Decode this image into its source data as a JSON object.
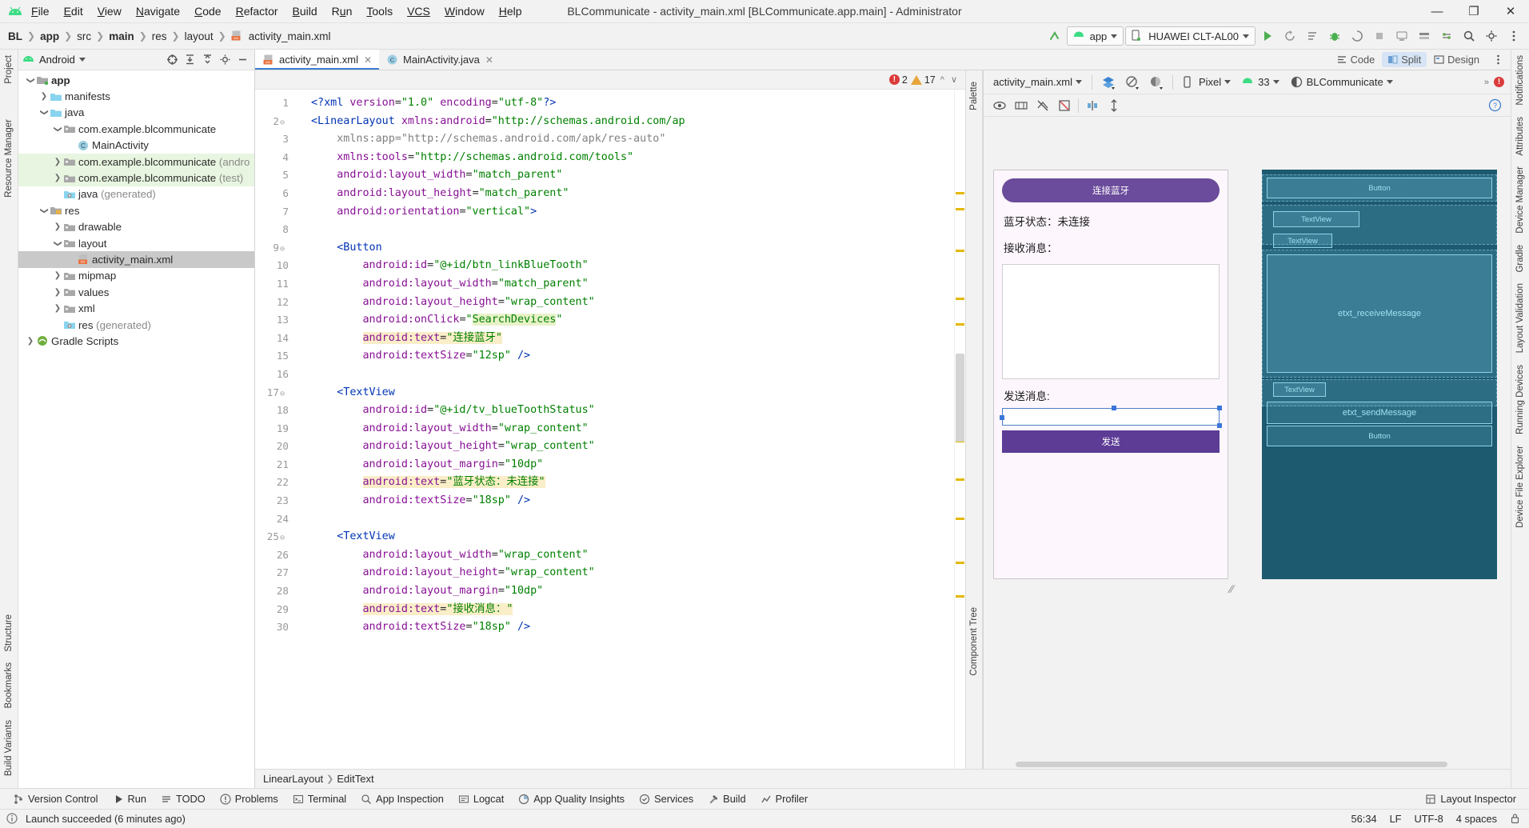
{
  "window": {
    "title": "BLCommunicate - activity_main.xml [BLCommunicate.app.main] - Administrator",
    "minimize": "—",
    "maximize": "❐",
    "close": "✕"
  },
  "menu": {
    "items": [
      {
        "label": "File",
        "mnemonic": "F"
      },
      {
        "label": "Edit",
        "mnemonic": "E"
      },
      {
        "label": "View",
        "mnemonic": "V"
      },
      {
        "label": "Navigate",
        "mnemonic": "N"
      },
      {
        "label": "Code",
        "mnemonic": "C"
      },
      {
        "label": "Refactor",
        "mnemonic": "R"
      },
      {
        "label": "Build",
        "mnemonic": "B"
      },
      {
        "label": "Run",
        "mnemonic": "u"
      },
      {
        "label": "Tools",
        "mnemonic": "T"
      },
      {
        "label": "VCS",
        "mnemonic": ""
      },
      {
        "label": "Window",
        "mnemonic": "W"
      },
      {
        "label": "Help",
        "mnemonic": "H"
      }
    ]
  },
  "breadcrumb": {
    "segments": [
      "BL",
      "app",
      "src",
      "main",
      "res",
      "layout",
      "activity_main.xml"
    ]
  },
  "toolbar": {
    "run_config": "app",
    "device": "HUAWEI CLT-AL00",
    "run_title": "Run",
    "debug_title": "Debug",
    "search_title": "Search Everywhere",
    "settings_title": "Settings"
  },
  "project": {
    "panel_title": "Android",
    "tree": [
      {
        "label": "app",
        "depth": 0,
        "arrow": "down",
        "icon": "module",
        "bold": true,
        "state": "normal"
      },
      {
        "label": "manifests",
        "depth": 1,
        "arrow": "right",
        "icon": "folder-blue",
        "bold": false,
        "state": "normal"
      },
      {
        "label": "java",
        "depth": 1,
        "arrow": "down",
        "icon": "folder-blue",
        "bold": false,
        "state": "normal"
      },
      {
        "label": "com.example.blcommunicate",
        "depth": 2,
        "arrow": "down",
        "icon": "package",
        "bold": false,
        "state": "normal"
      },
      {
        "label": "MainActivity",
        "depth": 3,
        "arrow": "none",
        "icon": "class",
        "bold": false,
        "state": "normal"
      },
      {
        "label": "com.example.blcommunicate (andro",
        "depth": 2,
        "arrow": "right",
        "icon": "package",
        "bold": false,
        "state": "green"
      },
      {
        "label": "com.example.blcommunicate (test)",
        "depth": 2,
        "arrow": "right",
        "icon": "package",
        "bold": false,
        "state": "green"
      },
      {
        "label": "java (generated)",
        "depth": 2,
        "arrow": "none",
        "icon": "folder-gen",
        "bold": false,
        "state": "normal",
        "dim_from": 5
      },
      {
        "label": "res",
        "depth": 1,
        "arrow": "down",
        "icon": "folder-res",
        "bold": false,
        "state": "normal"
      },
      {
        "label": "drawable",
        "depth": 2,
        "arrow": "right",
        "icon": "package",
        "bold": false,
        "state": "normal"
      },
      {
        "label": "layout",
        "depth": 2,
        "arrow": "down",
        "icon": "package",
        "bold": false,
        "state": "normal"
      },
      {
        "label": "activity_main.xml",
        "depth": 3,
        "arrow": "none",
        "icon": "xml-layout",
        "bold": false,
        "state": "selected"
      },
      {
        "label": "mipmap",
        "depth": 2,
        "arrow": "right",
        "icon": "package",
        "bold": false,
        "state": "normal"
      },
      {
        "label": "values",
        "depth": 2,
        "arrow": "right",
        "icon": "package",
        "bold": false,
        "state": "normal"
      },
      {
        "label": "xml",
        "depth": 2,
        "arrow": "right",
        "icon": "package",
        "bold": false,
        "state": "normal"
      },
      {
        "label": "res (generated)",
        "depth": 2,
        "arrow": "none",
        "icon": "folder-gen",
        "bold": false,
        "state": "normal",
        "dim_from": 4
      },
      {
        "label": "Gradle Scripts",
        "depth": 0,
        "arrow": "right",
        "icon": "gradle",
        "bold": false,
        "state": "normal"
      }
    ]
  },
  "left_rail": {
    "top": [
      "Project"
    ],
    "middle": [
      "Resource Manager"
    ],
    "bottom": [
      "Structure",
      "Bookmarks",
      "Build Variants"
    ]
  },
  "right_rail": {
    "items": [
      "Notifications",
      "Attributes",
      "Device Manager",
      "Gradle",
      "Layout Validation",
      "Running Devices",
      "Device File Explorer"
    ]
  },
  "editor": {
    "tabs": [
      {
        "label": "activity_main.xml",
        "icon": "xml-layout",
        "active": true
      },
      {
        "label": "MainActivity.java",
        "icon": "class",
        "active": false
      }
    ],
    "view_modes": [
      {
        "label": "Code",
        "active": false
      },
      {
        "label": "Split",
        "active": true
      },
      {
        "label": "Design",
        "active": false
      }
    ],
    "inspection": {
      "errors": "2",
      "warnings": "17"
    },
    "first_line": 1,
    "lines": [
      {
        "n": 1,
        "fold": false,
        "segments": [
          {
            "t": "<?xml ",
            "c": "k-tag"
          },
          {
            "t": "version",
            "c": "k-attr2"
          },
          {
            "t": "=",
            "c": "k-punc"
          },
          {
            "t": "\"1.0\"",
            "c": "k-val"
          },
          {
            "t": " ",
            "c": "k-punc"
          },
          {
            "t": "encoding",
            "c": "k-attr2"
          },
          {
            "t": "=",
            "c": "k-punc"
          },
          {
            "t": "\"utf-8\"",
            "c": "k-val"
          },
          {
            "t": "?>",
            "c": "k-tag"
          }
        ],
        "indent": 0
      },
      {
        "n": 2,
        "fold": true,
        "segments": [
          {
            "t": "<LinearLayout ",
            "c": "k-tag"
          },
          {
            "t": "xmlns:android",
            "c": "k-attr2"
          },
          {
            "t": "=",
            "c": "k-punc"
          },
          {
            "t": "\"http://schemas.android.com/ap",
            "c": "k-val"
          }
        ],
        "indent": 0
      },
      {
        "n": 3,
        "fold": false,
        "segments": [
          {
            "t": "xmlns:app",
            "c": "k-gray"
          },
          {
            "t": "=",
            "c": "k-gray"
          },
          {
            "t": "\"http://schemas.android.com/apk/res-auto\"",
            "c": "k-gray"
          }
        ],
        "indent": 1
      },
      {
        "n": 4,
        "fold": false,
        "segments": [
          {
            "t": "xmlns:tools",
            "c": "k-attr2"
          },
          {
            "t": "=",
            "c": "k-punc"
          },
          {
            "t": "\"http://schemas.android.com/tools\"",
            "c": "k-val"
          }
        ],
        "indent": 1
      },
      {
        "n": 5,
        "fold": false,
        "segments": [
          {
            "t": "android:layout_width",
            "c": "k-attr2"
          },
          {
            "t": "=",
            "c": "k-punc"
          },
          {
            "t": "\"match_parent\"",
            "c": "k-val"
          }
        ],
        "indent": 1
      },
      {
        "n": 6,
        "fold": false,
        "segments": [
          {
            "t": "android:layout_height",
            "c": "k-attr2"
          },
          {
            "t": "=",
            "c": "k-punc"
          },
          {
            "t": "\"match_parent\"",
            "c": "k-val"
          }
        ],
        "indent": 1
      },
      {
        "n": 7,
        "fold": false,
        "segments": [
          {
            "t": "android:orientation",
            "c": "k-attr2"
          },
          {
            "t": "=",
            "c": "k-punc"
          },
          {
            "t": "\"vertical\"",
            "c": "k-val"
          },
          {
            "t": ">",
            "c": "k-tag"
          }
        ],
        "indent": 1
      },
      {
        "n": 8,
        "fold": false,
        "segments": [],
        "indent": 0
      },
      {
        "n": 9,
        "fold": true,
        "segments": [
          {
            "t": "<Button",
            "c": "k-tag"
          }
        ],
        "indent": 1
      },
      {
        "n": 10,
        "fold": false,
        "segments": [
          {
            "t": "android:id",
            "c": "k-attr2"
          },
          {
            "t": "=",
            "c": "k-punc"
          },
          {
            "t": "\"@+id/btn_linkBlueTooth\"",
            "c": "k-val"
          }
        ],
        "indent": 2
      },
      {
        "n": 11,
        "fold": false,
        "segments": [
          {
            "t": "android:layout_width",
            "c": "k-attr2"
          },
          {
            "t": "=",
            "c": "k-punc"
          },
          {
            "t": "\"match_parent\"",
            "c": "k-val"
          }
        ],
        "indent": 2
      },
      {
        "n": 12,
        "fold": false,
        "segments": [
          {
            "t": "android:layout_height",
            "c": "k-attr2"
          },
          {
            "t": "=",
            "c": "k-punc"
          },
          {
            "t": "\"wrap_content\"",
            "c": "k-val"
          }
        ],
        "indent": 2
      },
      {
        "n": 13,
        "fold": false,
        "segments": [
          {
            "t": "android:onClick",
            "c": "k-attr2"
          },
          {
            "t": "=",
            "c": "k-punc"
          },
          {
            "t": "\"",
            "c": "k-val"
          },
          {
            "t": "SearchDevices",
            "c": "k-val hl2"
          },
          {
            "t": "\"",
            "c": "k-val"
          }
        ],
        "indent": 2
      },
      {
        "n": 14,
        "fold": false,
        "segments": [
          {
            "t": "android:text",
            "c": "k-attr2 hl"
          },
          {
            "t": "=",
            "c": "k-punc hl"
          },
          {
            "t": "\"连接蓝牙\"",
            "c": "k-val hl"
          }
        ],
        "indent": 2
      },
      {
        "n": 15,
        "fold": false,
        "segments": [
          {
            "t": "android:textSize",
            "c": "k-attr2"
          },
          {
            "t": "=",
            "c": "k-punc"
          },
          {
            "t": "\"12sp\"",
            "c": "k-val"
          },
          {
            "t": " />",
            "c": "k-tag"
          }
        ],
        "indent": 2
      },
      {
        "n": 16,
        "fold": false,
        "segments": [],
        "indent": 0
      },
      {
        "n": 17,
        "fold": true,
        "segments": [
          {
            "t": "<TextView",
            "c": "k-tag"
          }
        ],
        "indent": 1
      },
      {
        "n": 18,
        "fold": false,
        "segments": [
          {
            "t": "android:id",
            "c": "k-attr2"
          },
          {
            "t": "=",
            "c": "k-punc"
          },
          {
            "t": "\"@+id/tv_blueToothStatus\"",
            "c": "k-val"
          }
        ],
        "indent": 2
      },
      {
        "n": 19,
        "fold": false,
        "segments": [
          {
            "t": "android:layout_width",
            "c": "k-attr2"
          },
          {
            "t": "=",
            "c": "k-punc"
          },
          {
            "t": "\"wrap_content\"",
            "c": "k-val"
          }
        ],
        "indent": 2
      },
      {
        "n": 20,
        "fold": false,
        "segments": [
          {
            "t": "android:layout_height",
            "c": "k-attr2"
          },
          {
            "t": "=",
            "c": "k-punc"
          },
          {
            "t": "\"wrap_content\"",
            "c": "k-val"
          }
        ],
        "indent": 2
      },
      {
        "n": 21,
        "fold": false,
        "segments": [
          {
            "t": "android:layout_margin",
            "c": "k-attr2"
          },
          {
            "t": "=",
            "c": "k-punc"
          },
          {
            "t": "\"10dp\"",
            "c": "k-val"
          }
        ],
        "indent": 2
      },
      {
        "n": 22,
        "fold": false,
        "segments": [
          {
            "t": "android:text",
            "c": "k-attr2 hl"
          },
          {
            "t": "=",
            "c": "k-punc hl"
          },
          {
            "t": "\"蓝牙状态：未连接\"",
            "c": "k-val hl"
          }
        ],
        "indent": 2
      },
      {
        "n": 23,
        "fold": false,
        "segments": [
          {
            "t": "android:textSize",
            "c": "k-attr2"
          },
          {
            "t": "=",
            "c": "k-punc"
          },
          {
            "t": "\"18sp\"",
            "c": "k-val"
          },
          {
            "t": " />",
            "c": "k-tag"
          }
        ],
        "indent": 2
      },
      {
        "n": 24,
        "fold": false,
        "segments": [],
        "indent": 0
      },
      {
        "n": 25,
        "fold": true,
        "segments": [
          {
            "t": "<TextView",
            "c": "k-tag"
          }
        ],
        "indent": 1
      },
      {
        "n": 26,
        "fold": false,
        "segments": [
          {
            "t": "android:layout_width",
            "c": "k-attr2"
          },
          {
            "t": "=",
            "c": "k-punc"
          },
          {
            "t": "\"wrap_content\"",
            "c": "k-val"
          }
        ],
        "indent": 2
      },
      {
        "n": 27,
        "fold": false,
        "segments": [
          {
            "t": "android:layout_height",
            "c": "k-attr2"
          },
          {
            "t": "=",
            "c": "k-punc"
          },
          {
            "t": "\"wrap_content\"",
            "c": "k-val"
          }
        ],
        "indent": 2
      },
      {
        "n": 28,
        "fold": false,
        "segments": [
          {
            "t": "android:layout_margin",
            "c": "k-attr2"
          },
          {
            "t": "=",
            "c": "k-punc"
          },
          {
            "t": "\"10dp\"",
            "c": "k-val"
          }
        ],
        "indent": 2
      },
      {
        "n": 29,
        "fold": false,
        "segments": [
          {
            "t": "android:text",
            "c": "k-attr2 hl"
          },
          {
            "t": "=",
            "c": "k-punc hl"
          },
          {
            "t": "\"接收消息：\"",
            "c": "k-val hl"
          }
        ],
        "indent": 2
      },
      {
        "n": 30,
        "fold": false,
        "segments": [
          {
            "t": "android:textSize",
            "c": "k-attr2"
          },
          {
            "t": "=",
            "c": "k-punc"
          },
          {
            "t": "\"18sp\"",
            "c": "k-val"
          },
          {
            "t": " />",
            "c": "k-tag"
          }
        ],
        "indent": 2
      }
    ],
    "component_breadcrumb": [
      "LinearLayout",
      "EditText"
    ],
    "palette_label": "Palette",
    "component_tree_label": "Component Tree"
  },
  "design": {
    "file_selector": "activity_main.xml",
    "device": "Pixel",
    "api_level": "33",
    "theme": "BLCommunicate",
    "preview": {
      "button_connect": "连接蓝牙",
      "status_text": "蓝牙状态：未连接",
      "receive_label": "接收消息：",
      "send_label": "发送消息:",
      "button_send": "发送"
    },
    "blueprint": [
      {
        "label": "Button",
        "id": "btn_linkBlueTooth"
      },
      {
        "label": "TextView",
        "id": "tv_blueToothStatus"
      },
      {
        "label": "TextView",
        "id": "tv_receive"
      },
      {
        "label": "etxt_receiveMessage",
        "id": "etxt_receiveMessage"
      },
      {
        "label": "TextView",
        "id": "tv_send"
      },
      {
        "label": "etxt_sendMessage",
        "id": "etxt_sendMessage"
      },
      {
        "label": "Button",
        "id": "btn_send"
      }
    ]
  },
  "bottom_tools": [
    {
      "label": "Version Control",
      "icon": "branch-icon"
    },
    {
      "label": "Run",
      "icon": "play-icon"
    },
    {
      "label": "TODO",
      "icon": "list-icon"
    },
    {
      "label": "Problems",
      "icon": "warning-icon"
    },
    {
      "label": "Terminal",
      "icon": "terminal-icon"
    },
    {
      "label": "App Inspection",
      "icon": "inspect-icon"
    },
    {
      "label": "Logcat",
      "icon": "logcat-icon"
    },
    {
      "label": "App Quality Insights",
      "icon": "insights-icon"
    },
    {
      "label": "Services",
      "icon": "services-icon"
    },
    {
      "label": "Build",
      "icon": "hammer-icon"
    },
    {
      "label": "Profiler",
      "icon": "profiler-icon"
    }
  ],
  "bottom_right_tool": {
    "label": "Layout Inspector",
    "icon": "layout-inspector-icon"
  },
  "statusbar": {
    "message": "Launch succeeded (6 minutes ago)",
    "caret": "56:34",
    "line_sep": "LF",
    "encoding": "UTF-8",
    "indent": "4 spaces"
  },
  "colors": {
    "accent_green": "#3ddc84",
    "error_red": "#db3b3b",
    "warning_amber": "#e7a53a",
    "purple_button": "#6b4b9b",
    "blueprint_bg": "#1d5a70",
    "selection_gray": "#c9c9c9",
    "tab_underline": "#3c7fd0"
  }
}
